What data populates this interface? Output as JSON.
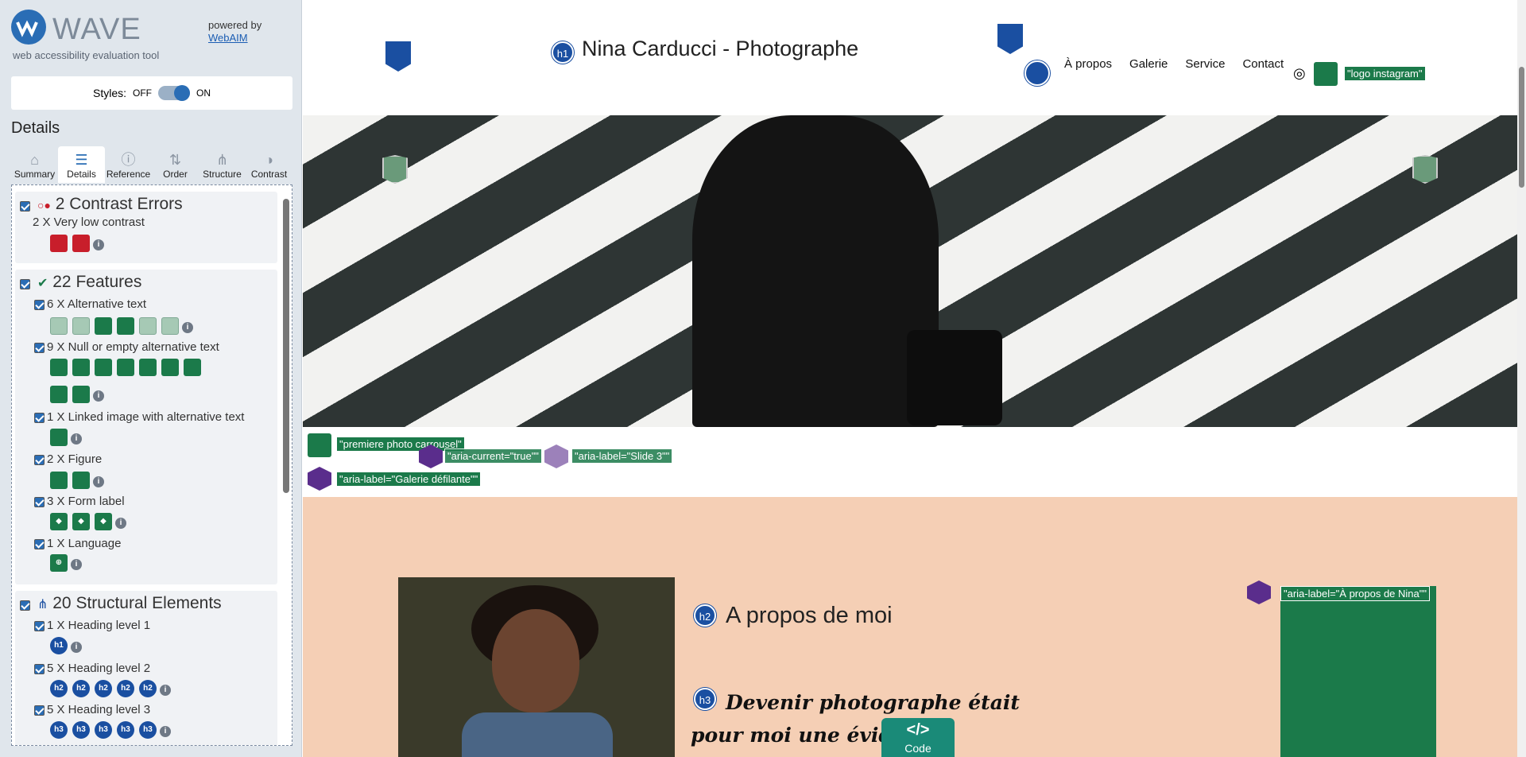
{
  "sidebar": {
    "logo_word": "WAVE",
    "logo_sub": "web accessibility evaluation tool",
    "powered_by": "powered by",
    "powered_link": "WebAIM",
    "styles_label": "Styles:",
    "toggle_off": "OFF",
    "toggle_on": "ON",
    "details_title": "Details",
    "tabs": [
      {
        "label": "Summary",
        "icon": "home-icon"
      },
      {
        "label": "Details",
        "icon": "list-icon"
      },
      {
        "label": "Reference",
        "icon": "info-icon"
      },
      {
        "label": "Order",
        "icon": "order-icon"
      },
      {
        "label": "Structure",
        "icon": "structure-icon"
      },
      {
        "label": "Contrast",
        "icon": "contrast-icon"
      }
    ],
    "sections": {
      "contrast": {
        "title": "2 Contrast Errors",
        "items": [
          {
            "label": "2 X Very low contrast"
          }
        ]
      },
      "features": {
        "title": "22 Features",
        "items": [
          {
            "label": "6 X Alternative text"
          },
          {
            "label": "9 X Null or empty alternative text"
          },
          {
            "label": "1 X Linked image with alternative text"
          },
          {
            "label": "2 X Figure"
          },
          {
            "label": "3 X Form label"
          },
          {
            "label": "1 X Language"
          }
        ]
      },
      "structural": {
        "title": "20 Structural Elements",
        "items": [
          {
            "label": "1 X Heading level 1"
          },
          {
            "label": "5 X Heading level 2"
          },
          {
            "label": "5 X Heading level 3"
          }
        ]
      }
    },
    "heading_badges": {
      "h1": "h1",
      "h2": "h2",
      "h3": "h3"
    }
  },
  "site": {
    "title": "Nina Carducci - Photographe",
    "title_badge": "h1",
    "nav": [
      "À propos",
      "Galerie",
      "Service",
      "Contact"
    ],
    "instagram_label": "\"logo instagram\"",
    "slide_labels": {
      "first_photo": "\"premiere photo carrousel\"",
      "aria_current": "\"aria-current=\"true\"\"",
      "slide": "\"aria-label=\"Slide 3\"\"",
      "gallery": "\"aria-label=\"Galerie défilante\"\""
    },
    "about": {
      "badge": "h2",
      "title": "A propos de moi",
      "sub_badge": "h3",
      "subtitle": "Devenir photographe était pour moi une évidence comme si j'étais née pour ça",
      "aria_label": "\"aria-label=\"À propos de Nina\"\""
    },
    "code_button": "Code"
  },
  "colors": {
    "wave_blue": "#2a6db5",
    "feature_green": "#1b7a4a",
    "aria_purple": "#5a2d8c",
    "error_red": "#c81e2b",
    "about_bg": "#f5cfb5",
    "code_teal": "#1a8a78"
  }
}
